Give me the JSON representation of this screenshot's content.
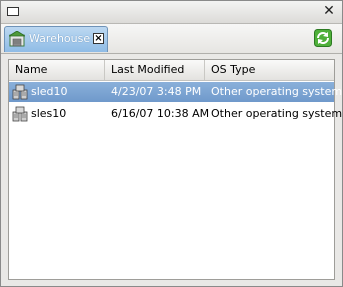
{
  "window": {
    "title": ""
  },
  "tabs": [
    {
      "label": "Warehouse",
      "active": true
    }
  ],
  "table": {
    "columns": [
      "Name",
      "Last Modified",
      "OS Type"
    ],
    "rows": [
      {
        "name": "sled10",
        "modified": "4/23/07 3:48 PM",
        "os": "Other operating system",
        "selected": true
      },
      {
        "name": "sles10",
        "modified": "6/16/07 10:38 AM",
        "os": "Other operating system",
        "selected": false
      }
    ]
  },
  "icons": {
    "tab": "warehouse-icon",
    "refresh": "refresh-icon",
    "row": "vm-machine-icon"
  },
  "colors": {
    "tab_active": "#8fbce6",
    "selection": "#7aa3d2",
    "refresh_green": "#3aa32a"
  }
}
